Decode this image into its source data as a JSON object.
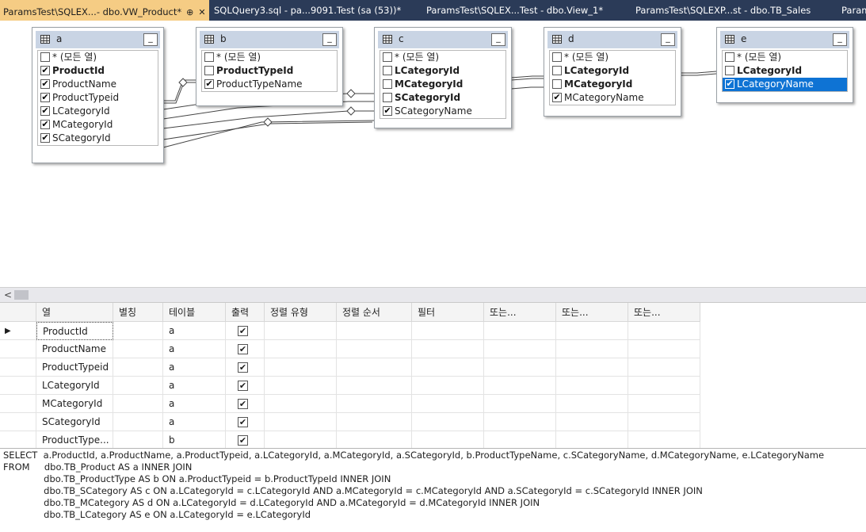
{
  "tabs": [
    {
      "label": "ParamsTest\\SQLEX...- dbo.VW_Product*",
      "active": true,
      "pin": "⊕",
      "close": "✕"
    },
    {
      "label": "SQLQuery3.sql - pa...9091.Test (sa (53))*",
      "active": false
    },
    {
      "label": "ParamsTest\\SQLEX...Test - dbo.View_1*",
      "active": false
    },
    {
      "label": "ParamsTest\\SQLEXP...st - dbo.TB_Sales",
      "active": false
    },
    {
      "label": "Param",
      "active": false
    }
  ],
  "tables": [
    {
      "name": "a",
      "columns": [
        {
          "label": "* (모든 열)",
          "checked": false,
          "key": false
        },
        {
          "label": "ProductId",
          "checked": true,
          "key": true
        },
        {
          "label": "ProductName",
          "checked": true,
          "key": false
        },
        {
          "label": "ProductTypeid",
          "checked": true,
          "key": false
        },
        {
          "label": "LCategoryId",
          "checked": true,
          "key": false
        },
        {
          "label": "MCategoryId",
          "checked": true,
          "key": false
        },
        {
          "label": "SCategoryId",
          "checked": true,
          "key": false
        }
      ]
    },
    {
      "name": "b",
      "columns": [
        {
          "label": "* (모든 열)",
          "checked": false,
          "key": false
        },
        {
          "label": "ProductTypeId",
          "checked": false,
          "key": true
        },
        {
          "label": "ProductTypeName",
          "checked": true,
          "key": false
        }
      ]
    },
    {
      "name": "c",
      "columns": [
        {
          "label": "* (모든 열)",
          "checked": false,
          "key": false
        },
        {
          "label": "LCategoryId",
          "checked": false,
          "key": true
        },
        {
          "label": "MCategoryId",
          "checked": false,
          "key": true
        },
        {
          "label": "SCategoryId",
          "checked": false,
          "key": true
        },
        {
          "label": "SCategoryName",
          "checked": true,
          "key": false
        }
      ]
    },
    {
      "name": "d",
      "columns": [
        {
          "label": "* (모든 열)",
          "checked": false,
          "key": false
        },
        {
          "label": "LCategoryId",
          "checked": false,
          "key": true
        },
        {
          "label": "MCategoryId",
          "checked": false,
          "key": true
        },
        {
          "label": "MCategoryName",
          "checked": true,
          "key": false
        }
      ]
    },
    {
      "name": "e",
      "columns": [
        {
          "label": "* (모든 열)",
          "checked": false,
          "key": false
        },
        {
          "label": "LCategoryId",
          "checked": false,
          "key": true
        },
        {
          "label": "LCategoryName",
          "checked": true,
          "key": false,
          "selected": true
        }
      ]
    }
  ],
  "minimize_glyph": "_",
  "scroll_left_glyph": "<",
  "grid": {
    "headers": [
      "열",
      "별칭",
      "테이블",
      "출력",
      "정렬 유형",
      "정렬 순서",
      "필터",
      "또는...",
      "또는...",
      "또는..."
    ],
    "rows": [
      {
        "column": "ProductId",
        "alias": "",
        "table": "a",
        "output": true,
        "current": true
      },
      {
        "column": "ProductName",
        "alias": "",
        "table": "a",
        "output": true
      },
      {
        "column": "ProductTypeid",
        "alias": "",
        "table": "a",
        "output": true
      },
      {
        "column": "LCategoryId",
        "alias": "",
        "table": "a",
        "output": true
      },
      {
        "column": "MCategoryId",
        "alias": "",
        "table": "a",
        "output": true
      },
      {
        "column": "SCategoryId",
        "alias": "",
        "table": "a",
        "output": true
      },
      {
        "column": "ProductType...",
        "alias": "",
        "table": "b",
        "output": true
      }
    ]
  },
  "sql": [
    "SELECT  a.ProductId, a.ProductName, a.ProductTypeid, a.LCategoryId, a.MCategoryId, a.SCategoryId, b.ProductTypeName, c.SCategoryName, d.MCategoryName, e.LCategoryName",
    "FROM     dbo.TB_Product AS a INNER JOIN",
    "              dbo.TB_ProductType AS b ON a.ProductTypeid = b.ProductTypeId INNER JOIN",
    "              dbo.TB_SCategory AS c ON a.LCategoryId = c.LCategoryId AND a.MCategoryId = c.MCategoryId AND a.SCategoryId = c.SCategoryId INNER JOIN",
    "              dbo.TB_MCategory AS d ON a.LCategoryId = d.LCategoryId AND a.MCategoryId = d.MCategoryId INNER JOIN",
    "              dbo.TB_LCategory AS e ON a.LCategoryId = e.LCategoryId"
  ],
  "colors": {
    "tabstrip": "#2b3b58",
    "active_tab": "#f5cc84",
    "selection": "#0e73d4",
    "table_header": "#c9d4e4"
  }
}
